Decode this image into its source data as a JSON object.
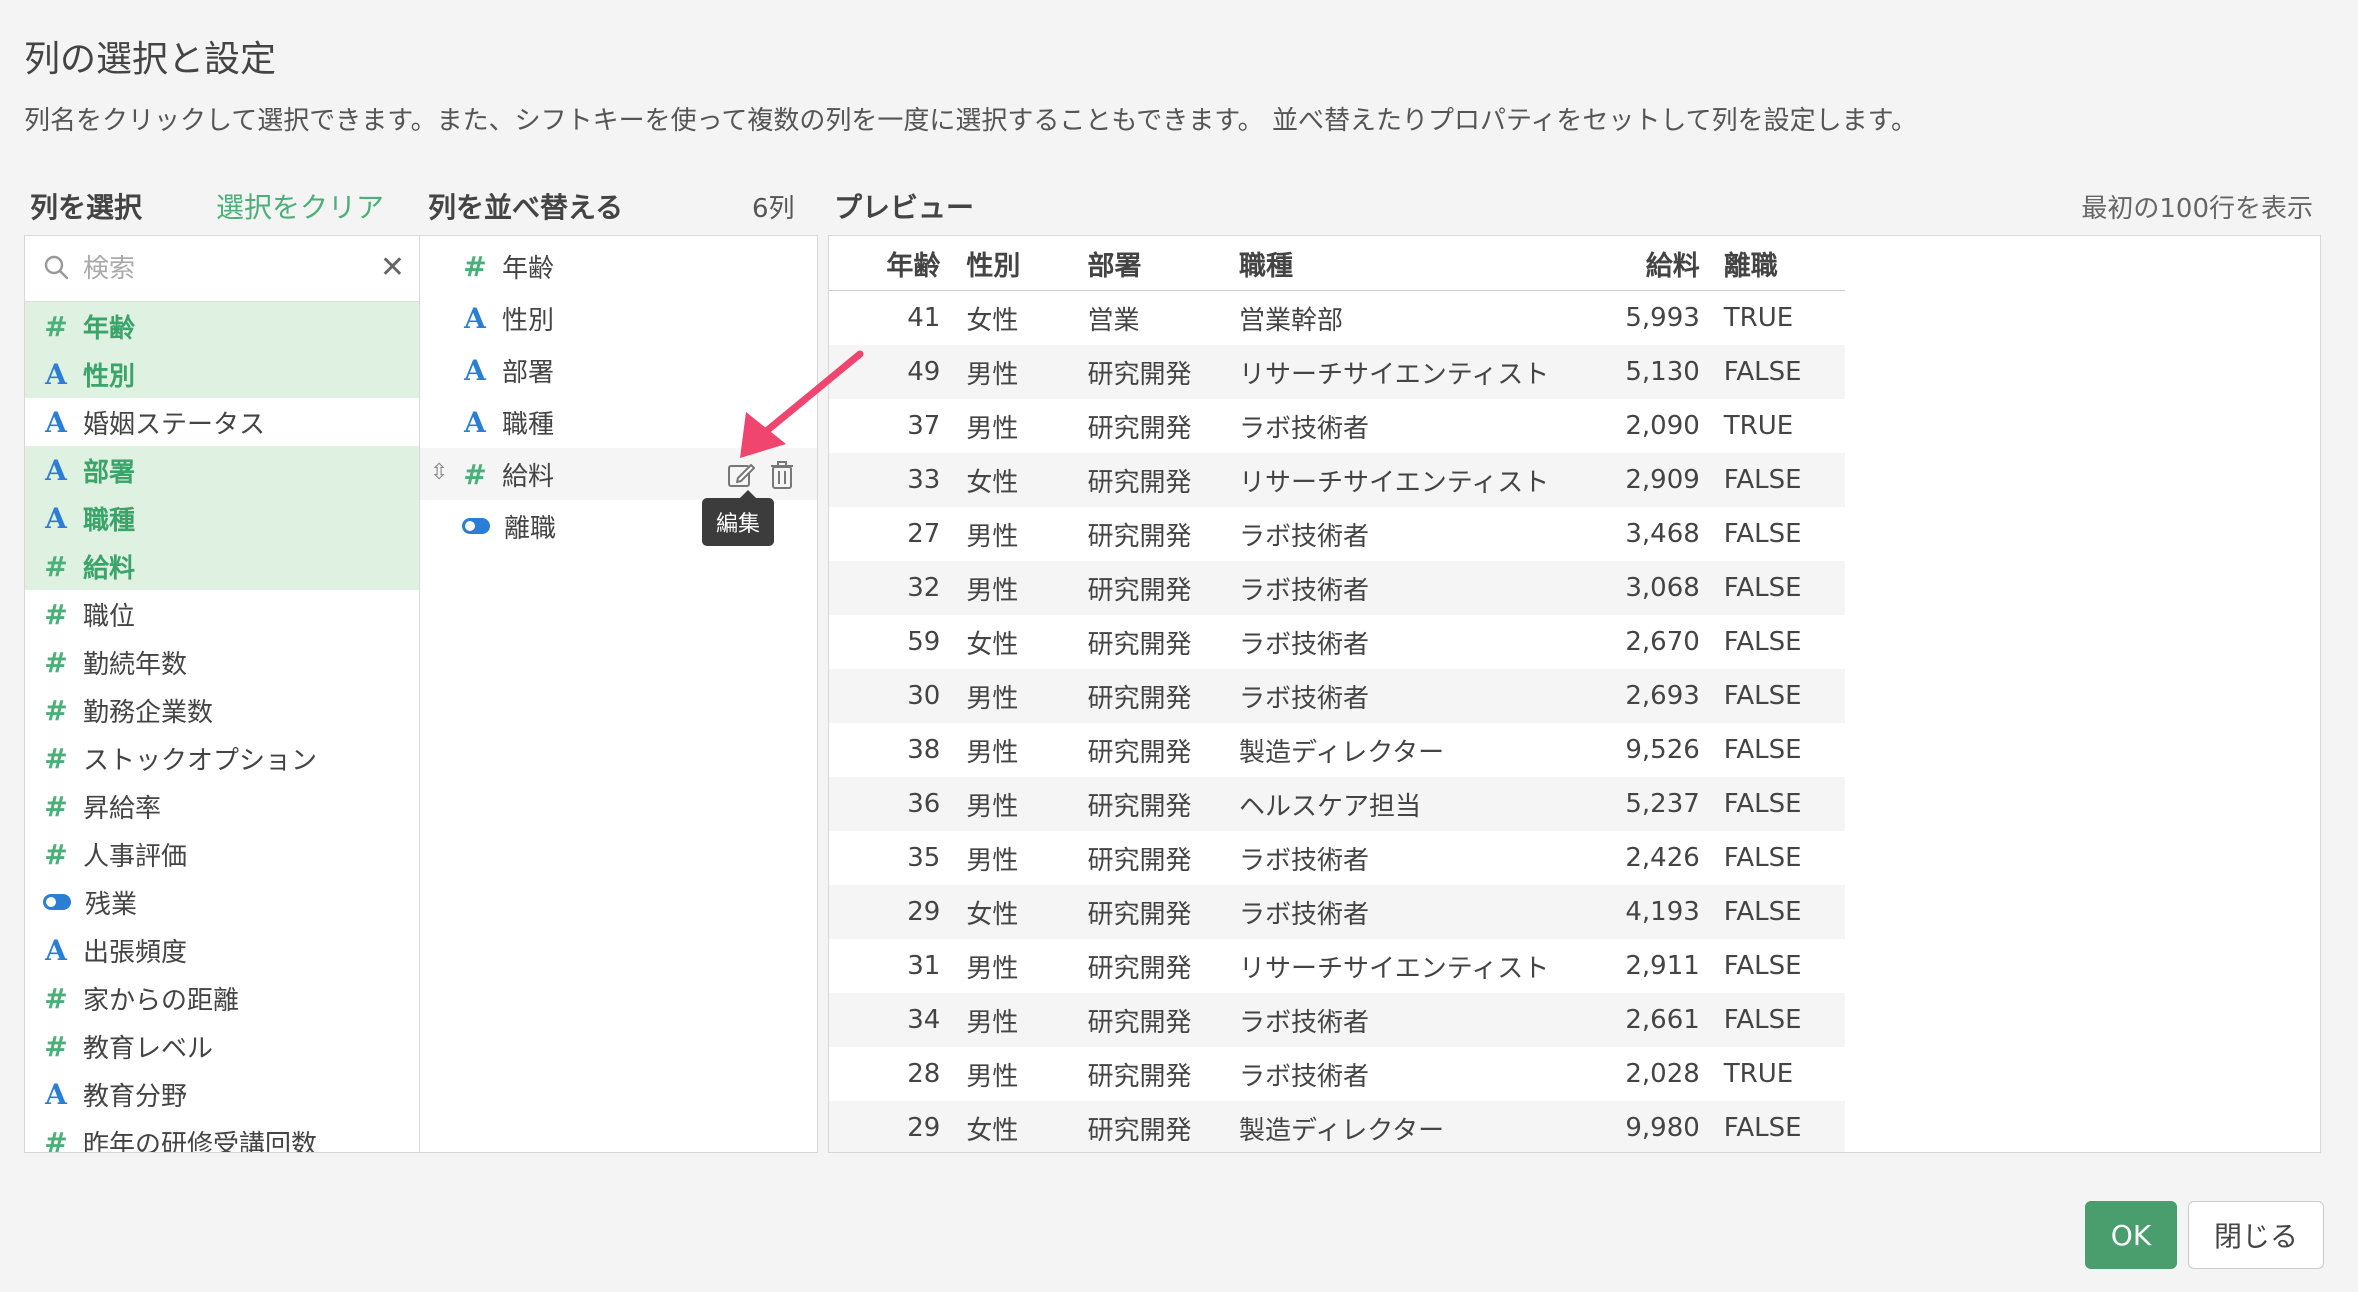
{
  "dialog": {
    "title": "列の選択と設定",
    "subtitle": "列名をクリックして選択できます。また、シフトキーを使って複数の列を一度に選択することもできます。 並べ替えたりプロパティをセットして列を設定します。"
  },
  "select_section": {
    "heading": "列を選択",
    "clear_label": "選択をクリア",
    "search_placeholder": "検索",
    "columns": [
      {
        "label": "年齢",
        "type": "number",
        "selected": true
      },
      {
        "label": "性別",
        "type": "string",
        "selected": true
      },
      {
        "label": "婚姻ステータス",
        "type": "string",
        "selected": false
      },
      {
        "label": "部署",
        "type": "string",
        "selected": true
      },
      {
        "label": "職種",
        "type": "string",
        "selected": true
      },
      {
        "label": "給料",
        "type": "number",
        "selected": true
      },
      {
        "label": "職位",
        "type": "number",
        "selected": false
      },
      {
        "label": "勤続年数",
        "type": "number",
        "selected": false
      },
      {
        "label": "勤務企業数",
        "type": "number",
        "selected": false
      },
      {
        "label": "ストックオプション",
        "type": "number",
        "selected": false
      },
      {
        "label": "昇給率",
        "type": "number",
        "selected": false
      },
      {
        "label": "人事評価",
        "type": "number",
        "selected": false
      },
      {
        "label": "残業",
        "type": "boolean",
        "selected": false
      },
      {
        "label": "出張頻度",
        "type": "string",
        "selected": false
      },
      {
        "label": "家からの距離",
        "type": "number",
        "selected": false
      },
      {
        "label": "教育レベル",
        "type": "number",
        "selected": false
      },
      {
        "label": "教育分野",
        "type": "string",
        "selected": false
      },
      {
        "label": "昨年の研修受講回数",
        "type": "number",
        "selected": false
      }
    ]
  },
  "order_section": {
    "heading": "列を並べ替える",
    "count": "6列",
    "items": [
      {
        "label": "年齢",
        "type": "number"
      },
      {
        "label": "性別",
        "type": "string"
      },
      {
        "label": "部署",
        "type": "string"
      },
      {
        "label": "職種",
        "type": "string"
      },
      {
        "label": "給料",
        "type": "number"
      },
      {
        "label": "離職",
        "type": "boolean"
      }
    ],
    "tooltip": "編集"
  },
  "preview": {
    "heading": "プレビュー",
    "note": "最初の100行を表示",
    "headers": [
      "年齢",
      "性別",
      "部署",
      "職種",
      "給料",
      "離職"
    ],
    "rows": [
      [
        "41",
        "女性",
        "営業",
        "営業幹部",
        "5,993",
        "TRUE"
      ],
      [
        "49",
        "男性",
        "研究開発",
        "リサーチサイエンティスト",
        "5,130",
        "FALSE"
      ],
      [
        "37",
        "男性",
        "研究開発",
        "ラボ技術者",
        "2,090",
        "TRUE"
      ],
      [
        "33",
        "女性",
        "研究開発",
        "リサーチサイエンティスト",
        "2,909",
        "FALSE"
      ],
      [
        "27",
        "男性",
        "研究開発",
        "ラボ技術者",
        "3,468",
        "FALSE"
      ],
      [
        "32",
        "男性",
        "研究開発",
        "ラボ技術者",
        "3,068",
        "FALSE"
      ],
      [
        "59",
        "女性",
        "研究開発",
        "ラボ技術者",
        "2,670",
        "FALSE"
      ],
      [
        "30",
        "男性",
        "研究開発",
        "ラボ技術者",
        "2,693",
        "FALSE"
      ],
      [
        "38",
        "男性",
        "研究開発",
        "製造ディレクター",
        "9,526",
        "FALSE"
      ],
      [
        "36",
        "男性",
        "研究開発",
        "ヘルスケア担当",
        "5,237",
        "FALSE"
      ],
      [
        "35",
        "男性",
        "研究開発",
        "ラボ技術者",
        "2,426",
        "FALSE"
      ],
      [
        "29",
        "女性",
        "研究開発",
        "ラボ技術者",
        "4,193",
        "FALSE"
      ],
      [
        "31",
        "男性",
        "研究開発",
        "リサーチサイエンティスト",
        "2,911",
        "FALSE"
      ],
      [
        "34",
        "男性",
        "研究開発",
        "ラボ技術者",
        "2,661",
        "FALSE"
      ],
      [
        "28",
        "男性",
        "研究開発",
        "ラボ技術者",
        "2,028",
        "TRUE"
      ],
      [
        "29",
        "女性",
        "研究開発",
        "製造ディレクター",
        "9,980",
        "FALSE"
      ]
    ]
  },
  "footer": {
    "ok_label": "OK",
    "close_label": "閉じる"
  },
  "colors": {
    "accent_green": "#4caf7a",
    "selected_bg": "#dff1e1",
    "string_blue": "#2a7fd4",
    "ok_button": "#4a9e6e",
    "arrow": "#f0456e"
  }
}
